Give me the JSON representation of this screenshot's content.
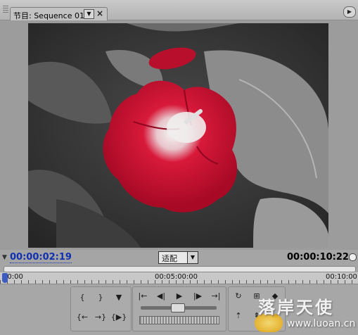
{
  "panel": {
    "tab_label": "节目: Sequence 01",
    "tab_dropdown_icon": "chevron-down-icon",
    "close_glyph": "×",
    "menu_icon": "panel-menu-icon"
  },
  "timecode": {
    "current": "00:00:02:19",
    "duration": "00:00:10:22",
    "current_color": "#1030b0"
  },
  "fit": {
    "label": "适配"
  },
  "ruler": {
    "labels": [
      "00:00",
      "00:05:00:00",
      "00:10:00"
    ]
  },
  "controls": {
    "mark_in": "mark-in-icon",
    "mark_out": "mark-out-icon",
    "set_marker": "marker-icon",
    "go_to_in": "go-to-in-icon",
    "step_back": "step-back-icon",
    "play": "play-icon",
    "step_forward": "step-forward-icon",
    "go_to_out": "go-to-out-icon",
    "go_prev_edit": "prev-edit-icon",
    "go_next_edit": "next-edit-icon",
    "play_in_to_out": "play-in-out-icon",
    "loop": "loop-icon",
    "safe_margins": "safe-margins-icon",
    "output": "output-icon",
    "lift": "lift-icon",
    "extract": "extract-icon",
    "trim": "trim-icon"
  },
  "watermark": {
    "text": "落岸天使",
    "url": "www.luoan.cn"
  },
  "video": {
    "subject": "red-flower-selective-color",
    "flower_color": "#c8102e"
  }
}
